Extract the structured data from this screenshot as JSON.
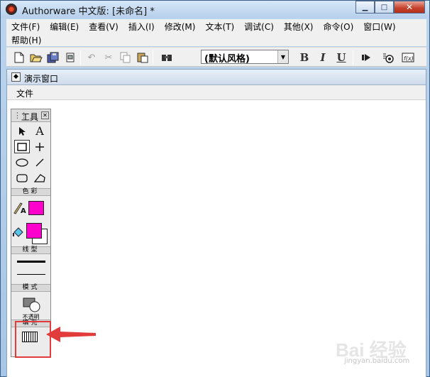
{
  "window": {
    "title": "Authorware 中文版: [未命名] *",
    "controls": {
      "minimize": "▁",
      "maximize": "□",
      "close": "✕"
    }
  },
  "menubar": {
    "items": [
      "文件(F)",
      "编辑(E)",
      "查看(V)",
      "插入(I)",
      "修改(M)",
      "文本(T)",
      "调试(C)",
      "其他(X)",
      "命令(O)",
      "窗口(W)",
      "帮助(H)"
    ]
  },
  "toolbar": {
    "style_value": "(默认风格)",
    "bold_label": "B",
    "italic_label": "I",
    "underline_label": "U"
  },
  "presentation_window": {
    "title": "演示窗口",
    "menu_items": [
      "文件"
    ]
  },
  "tool_palette": {
    "title": "工具",
    "sections": {
      "color": "色彩",
      "line": "线型",
      "mode": "模式",
      "fill": "填充"
    },
    "mode_value": "不透明",
    "pen_color": "#ff00cc",
    "fill_foreground_color": "#ff00cc",
    "fill_background_color": "#ffffff"
  },
  "annotation": {
    "highlight_color": "#e23b3b",
    "arrow_color": "#e23b3b"
  },
  "watermark": {
    "text": "Bai 经验",
    "subtext": "jingyan.baidu.com"
  }
}
